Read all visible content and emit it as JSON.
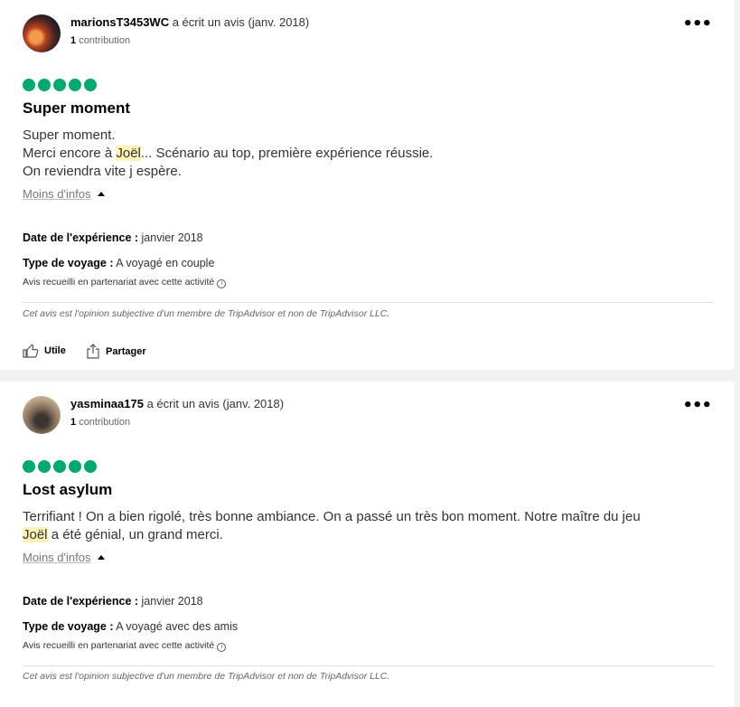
{
  "reviews": [
    {
      "username": "marionsT3453WC",
      "wrote": "a écrit un avis (janv. 2018)",
      "contrib_count": "1",
      "contrib_label": "contribution",
      "rating": 5,
      "title": "Super moment",
      "body_lines": [
        [
          "Super moment."
        ],
        [
          "Merci encore à ",
          "Joël",
          "... Scénario au top, première expérience réussie."
        ],
        [
          "On reviendra vite j espère."
        ]
      ],
      "less_label": "Moins d'infos",
      "date_label": "Date de l'expérience :",
      "date_value": "janvier 2018",
      "trip_label": "Type de voyage :",
      "trip_value": "A voyagé en couple",
      "partner": "Avis recueilli en partenariat avec cette activité",
      "disclaimer": "Cet avis est l'opinion subjective d'un membre de TripAdvisor et non de TripAdvisor LLC.",
      "helpful": "Utile",
      "share": "Partager"
    },
    {
      "username": "yasminaa175",
      "wrote": "a écrit un avis (janv. 2018)",
      "contrib_count": "1",
      "contrib_label": "contribution",
      "rating": 5,
      "title": "Lost asylum",
      "body_line1": "Terrifiant ! On a bien rigolé, très bonne ambiance. On a passé un très bon moment. Notre maître du jeu",
      "body_hl": "Joël",
      "body_line2": " a été génial, un grand merci.",
      "less_label": "Moins d'infos",
      "date_label": "Date de l'expérience :",
      "date_value": "janvier 2018",
      "trip_label": "Type de voyage :",
      "trip_value": "A voyagé avec des amis",
      "partner": "Avis recueilli en partenariat avec cette activité",
      "disclaimer": "Cet avis est l'opinion subjective d'un membre de TripAdvisor et non de TripAdvisor LLC."
    }
  ],
  "colors": {
    "rating": "#00aa6c",
    "highlight": "#fff3b5"
  },
  "icons": {
    "more": "more-options-icon",
    "thumb": "thumbs-up-icon",
    "share": "share-icon",
    "info": "info-icon"
  }
}
